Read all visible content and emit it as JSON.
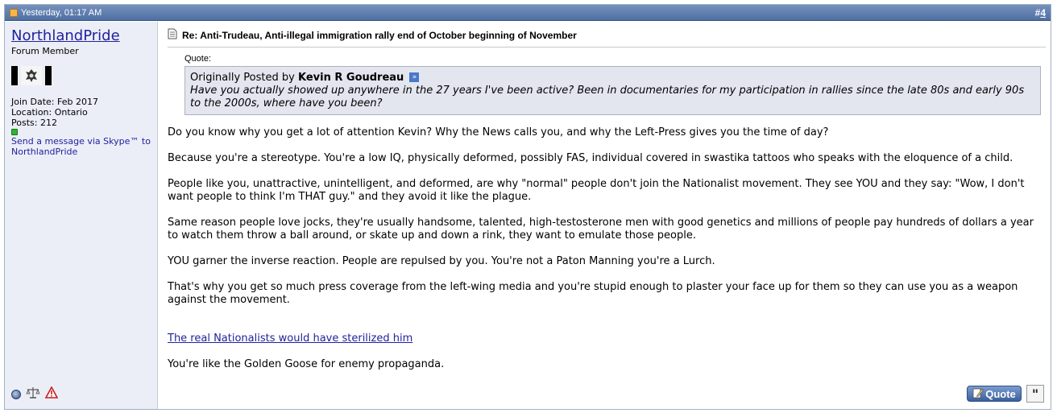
{
  "header": {
    "timestamp": "Yesterday, 01:17 AM",
    "post_hash": "#",
    "post_number": "4"
  },
  "user": {
    "username": "NorthlandPride",
    "title": "Forum Member",
    "join_date": "Join Date: Feb 2017",
    "location": "Location: Ontario",
    "posts": "Posts: 212",
    "skype_link": "Send a message via Skype™ to NorthlandPride"
  },
  "post": {
    "title": "Re: Anti-Trudeau, Anti-illegal immigration rally end of October beginning of November",
    "quote_label": "Quote:",
    "quote_prefix": "Originally Posted by",
    "quote_author": "Kevin R Goudreau",
    "quote_text": "Have you actually showed up anywhere in the 27 years I've been active? Been in documentaries for my participation in rallies since the late 80s and early 90s to the 2000s, where have you been?",
    "paragraphs": [
      "Do you know why you get a lot of attention Kevin? Why the News calls you, and why the Left-Press gives you the time of day?",
      "Because you're a stereotype. You're a low IQ, physically deformed, possibly FAS, individual covered in swastika tattoos who speaks with the eloquence of a child.",
      "People like you, unattractive, unintelligent, and deformed, are why \"normal\" people don't join the Nationalist movement. They see YOU and they say: \"Wow, I don't want people to think I'm THAT guy.\" and they avoid it like the plague.",
      "Same reason people love jocks, they're usually handsome, talented, high-testosterone men with good genetics and millions of people pay hundreds of dollars a year to watch them throw a ball around, or skate up and down a rink, they want to emulate those people.",
      "YOU garner the inverse reaction. People are repulsed by you. You're not a Paton Manning you're a Lurch.",
      "That's why you get so much press coverage from the left-wing media and you're stupid enough to plaster your face up for them so they can use you as a weapon against the movement."
    ],
    "link_text": "The real Nationalists would have sterilized him",
    "closing": "You're like the Golden Goose for enemy propaganda."
  },
  "buttons": {
    "quote": "Quote",
    "multiquote": "\""
  },
  "icons": {
    "header": "post-doc-icon",
    "title": "post-page-icon",
    "view_post": "view-post-arrow-icon",
    "online": "online-status-icon",
    "reputation": "reputation-icon",
    "scales": "scales-icon",
    "report": "report-warning-icon"
  },
  "colors": {
    "header_bg": "#5e7fb0",
    "sidebar_bg": "#ebeef7",
    "quote_bg": "#e3e6ef",
    "link": "#22229c",
    "online": "#2fb52f"
  }
}
